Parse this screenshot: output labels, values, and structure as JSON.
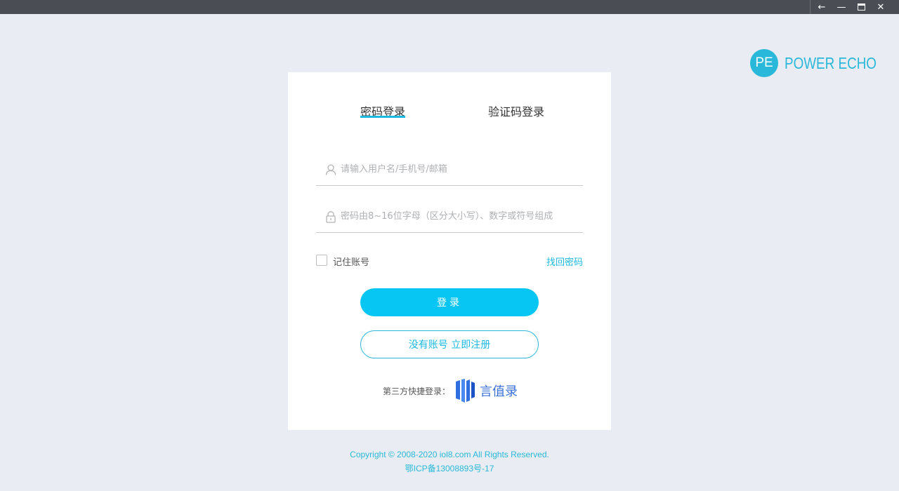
{
  "window": {
    "controls": {
      "back": "←",
      "minimize": "—",
      "maximize": "■",
      "close": "✕"
    }
  },
  "brand": {
    "badge": "PE",
    "name": "POWER ECHO",
    "color": "#29b8d9"
  },
  "login": {
    "tabs": [
      {
        "label": "密码登录",
        "active": true
      },
      {
        "label": "验证码登录",
        "active": false
      }
    ],
    "username": {
      "placeholder": "请输入用户名/手机号/邮箱",
      "value": "",
      "icon": "user-icon"
    },
    "password": {
      "placeholder": "密码由8~16位字母（区分大小写）、数字或符号组成",
      "value": "",
      "icon": "lock-icon"
    },
    "remember_label": "记住账号",
    "remember_checked": false,
    "forgot_label": "找回密码",
    "submit_label": "登录",
    "register_label": "没有账号 立即注册",
    "third_party_label": "第三方快捷登录：",
    "third_party_provider": "言值录"
  },
  "footer": {
    "copyright": "Copyright © 2008-2020 iol8.com All Rights Reserved.",
    "icp": "鄂ICP备13008893号-17"
  },
  "colors": {
    "accent": "#08c6f3",
    "link": "#1cb8e0",
    "background": "#e9edf3",
    "titlebar": "#4a4d54",
    "provider": "#3a6fd8"
  }
}
